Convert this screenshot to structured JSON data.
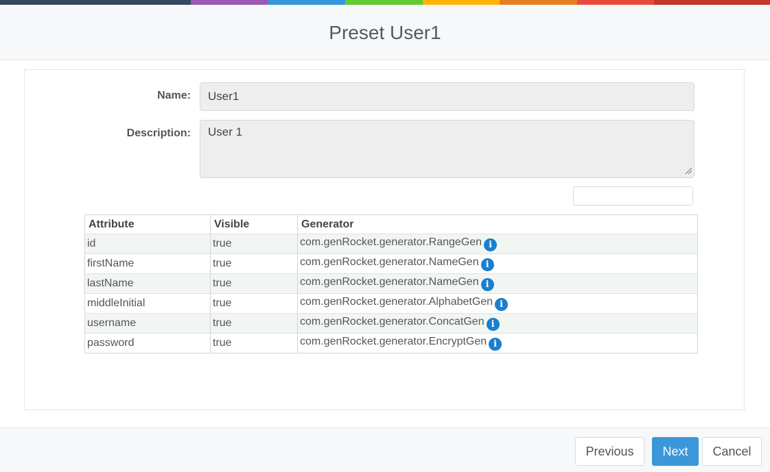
{
  "accent_colors": [
    "#34495e",
    "#9b59b6",
    "#3498db",
    "#62cb31",
    "#ffb606",
    "#e67e22",
    "#e74c3c",
    "#c0392b"
  ],
  "dialog": {
    "title": "Preset User1"
  },
  "form": {
    "name_label": "Name:",
    "name_value": "User1",
    "description_label": "Description:",
    "description_value": "User 1",
    "filter_value": ""
  },
  "table": {
    "headers": [
      "Attribute",
      "Visible",
      "Generator"
    ],
    "rows": [
      {
        "attribute": "id",
        "visible": "true",
        "generator": "com.genRocket.generator.RangeGen"
      },
      {
        "attribute": "firstName",
        "visible": "true",
        "generator": "com.genRocket.generator.NameGen"
      },
      {
        "attribute": "lastName",
        "visible": "true",
        "generator": "com.genRocket.generator.NameGen"
      },
      {
        "attribute": "middleInitial",
        "visible": "true",
        "generator": "com.genRocket.generator.AlphabetGen"
      },
      {
        "attribute": "username",
        "visible": "true",
        "generator": "com.genRocket.generator.ConcatGen"
      },
      {
        "attribute": "password",
        "visible": "true",
        "generator": "com.genRocket.generator.EncryptGen"
      }
    ],
    "row_icon": "info-icon"
  },
  "footer": {
    "previous_label": "Previous",
    "next_label": "Next",
    "cancel_label": "Cancel"
  }
}
